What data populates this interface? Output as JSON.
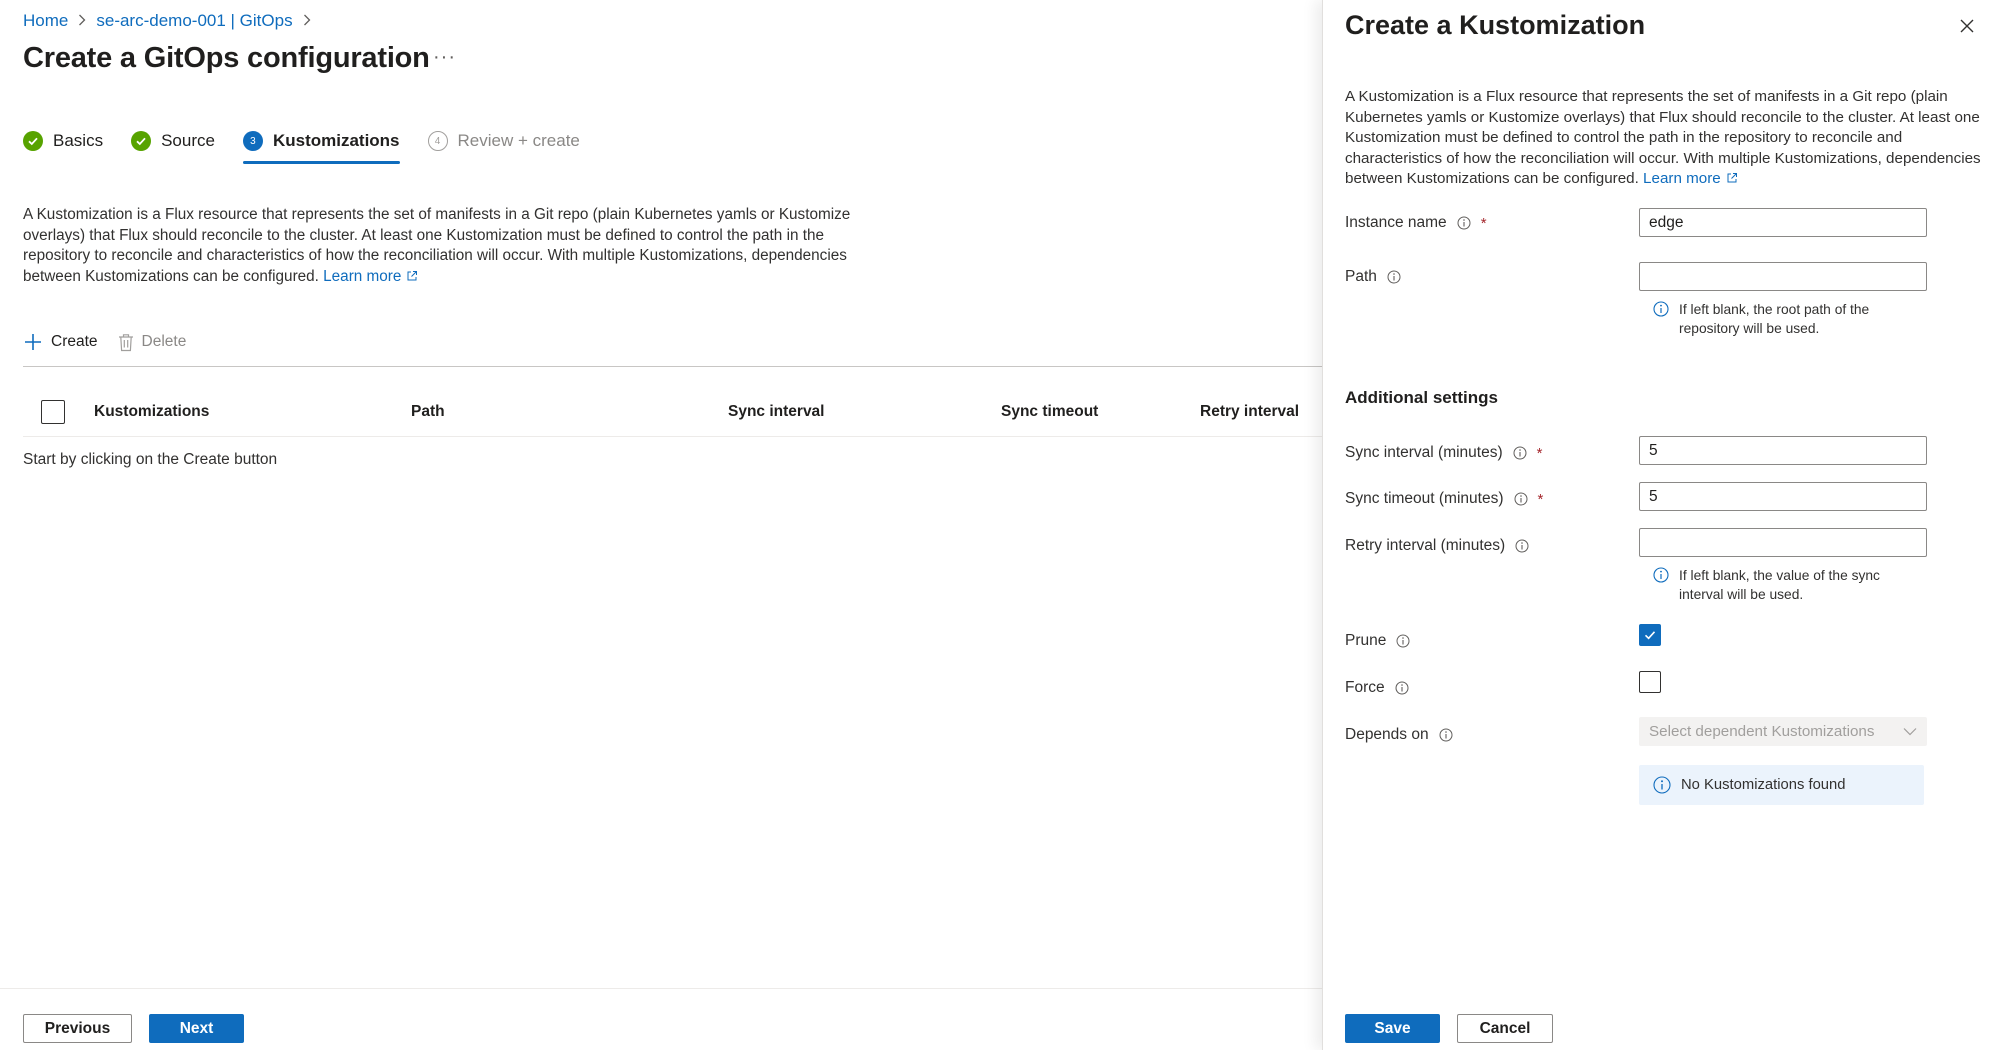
{
  "breadcrumb": {
    "home": "Home",
    "resource": "se-arc-demo-001 | GitOps",
    "separator": ">"
  },
  "page": {
    "title": "Create a GitOps configuration",
    "more": "···"
  },
  "wizard": {
    "steps": [
      {
        "label": "Basics",
        "state": "done"
      },
      {
        "label": "Source",
        "state": "done"
      },
      {
        "label": "Kustomizations",
        "state": "current",
        "number": "3"
      },
      {
        "label": "Review + create",
        "state": "pending",
        "number": "4"
      }
    ]
  },
  "main": {
    "description": "A Kustomization is a Flux resource that represents the set of manifests in a Git repo (plain Kubernetes yamls or Kustomize overlays) that Flux should reconcile to the cluster. At least one Kustomization must be defined to control the path in the repository to reconcile and characteristics of how the reconciliation will occur. With multiple Kustomizations, dependencies between Kustomizations can be configured.",
    "learn_more": "Learn more",
    "toolbar": {
      "create": "Create",
      "delete": "Delete"
    },
    "table": {
      "columns": [
        "Kustomizations",
        "Path",
        "Sync interval",
        "Sync timeout",
        "Retry interval"
      ],
      "empty_message": "Start by clicking on the Create button"
    },
    "footer": {
      "previous": "Previous",
      "next": "Next"
    }
  },
  "panel": {
    "title": "Create a Kustomization",
    "description": "A Kustomization is a Flux resource that represents the set of manifests in a Git repo (plain Kubernetes yamls or Kustomize overlays) that Flux should reconcile to the cluster. At least one Kustomization must be defined to control the path in the repository to reconcile and characteristics of how the reconciliation will occur. With multiple Kustomizations, dependencies between Kustomizations can be configured.",
    "learn_more": "Learn more",
    "fields": {
      "instance_name": {
        "label": "Instance name",
        "value": "edge",
        "required": "*"
      },
      "path": {
        "label": "Path",
        "value": "",
        "hint": "If left blank, the root path of the repository will be used."
      },
      "sync_interval": {
        "label": "Sync interval (minutes)",
        "value": "5",
        "required": "*"
      },
      "sync_timeout": {
        "label": "Sync timeout (minutes)",
        "value": "5",
        "required": "*"
      },
      "retry_interval": {
        "label": "Retry interval (minutes)",
        "value": "",
        "hint": "If left blank, the value of the sync interval will be used."
      },
      "prune": {
        "label": "Prune",
        "checked": true
      },
      "force": {
        "label": "Force",
        "checked": false
      },
      "depends_on": {
        "label": "Depends on",
        "placeholder": "Select dependent Kustomizations",
        "info": "No Kustomizations found"
      }
    },
    "additional_settings": "Additional settings",
    "footer": {
      "save": "Save",
      "cancel": "Cancel"
    }
  },
  "colors": {
    "accent": "#0f6cbd",
    "success": "#57a300",
    "required": "#a4262c",
    "info_bg": "#ebf3fc"
  }
}
